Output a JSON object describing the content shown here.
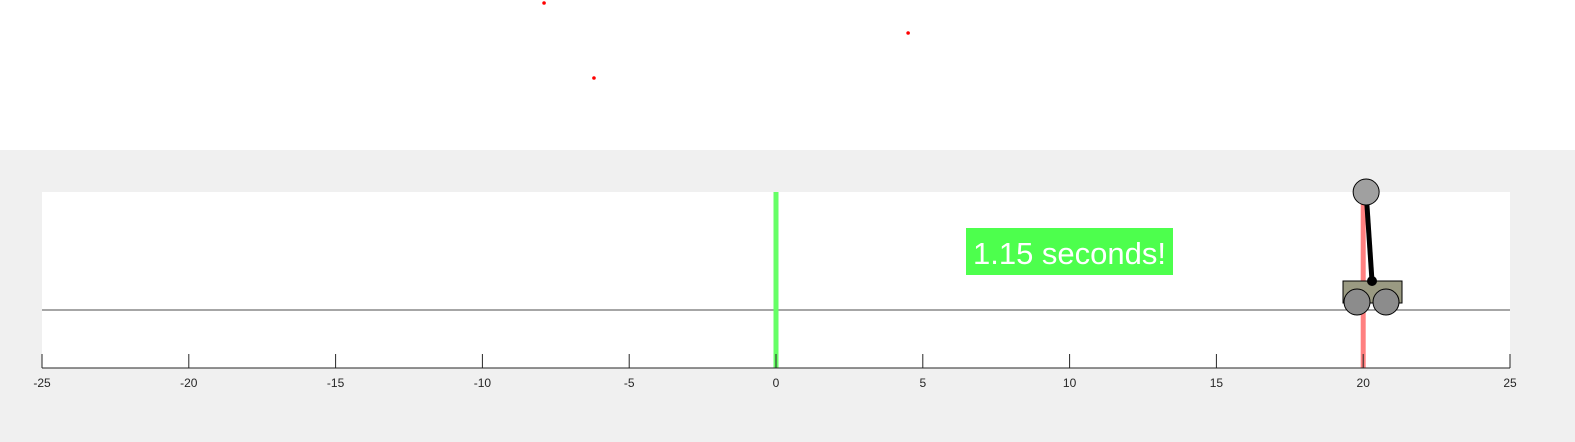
{
  "chart_data": {
    "type": "scatter",
    "title": "",
    "xlabel": "",
    "ylabel": "",
    "xlim": [
      -25,
      25
    ],
    "xticks": [
      "-25",
      "-20",
      "-15",
      "-10",
      "-5",
      "0",
      "5",
      "10",
      "15",
      "20",
      "25"
    ],
    "scatter_points": [
      {
        "x": -7.9,
        "y": 1.0
      },
      {
        "x": 4.5,
        "y": 0.8
      },
      {
        "x": -6.2,
        "y": 0.5
      }
    ],
    "track_y": 0,
    "start_line_x": 0,
    "target_line_x": 20,
    "cart_x": 20.3,
    "pole_tip_x": 20.1,
    "timer_text": "1.15 seconds!",
    "colors": {
      "points": "#ff0000",
      "start_line": "#66ff66",
      "target_line": "#ff8080",
      "timer_bg": "#4dff4d",
      "cart_body": "#9a9a82",
      "wheels": "#8c8c8c",
      "pole": "#000000",
      "pole_bob": "#a0a0a0"
    }
  }
}
